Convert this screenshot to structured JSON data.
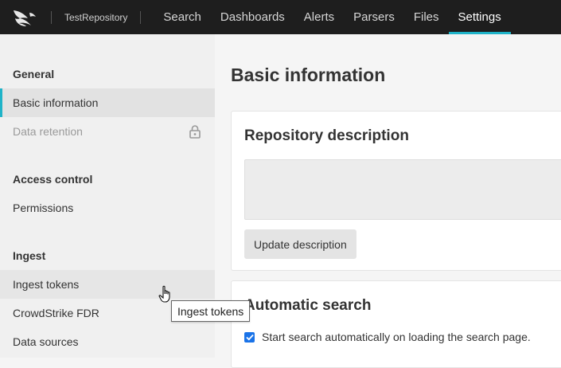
{
  "topbar": {
    "repository": "TestRepository",
    "nav": [
      "Search",
      "Dashboards",
      "Alerts",
      "Parsers",
      "Files",
      "Settings"
    ],
    "active": "Settings"
  },
  "sidebar": {
    "groups": [
      {
        "label": "General",
        "items": [
          "Basic information",
          "Data retention"
        ]
      },
      {
        "label": "Access control",
        "items": [
          "Permissions"
        ]
      },
      {
        "label": "Ingest",
        "items": [
          "Ingest tokens",
          "CrowdStrike FDR",
          "Data sources"
        ]
      }
    ]
  },
  "main": {
    "title": "Basic information",
    "description_card": {
      "title": "Repository description",
      "button": "Update description"
    },
    "search_card": {
      "title": "Automatic search",
      "checkbox_label": "Start search automatically on loading the search page.",
      "checked": true
    }
  },
  "tooltip": "Ingest tokens",
  "colors": {
    "accent": "#1fb3c8",
    "topbar": "#1e1e1e",
    "checkbox": "#1a73e8"
  }
}
